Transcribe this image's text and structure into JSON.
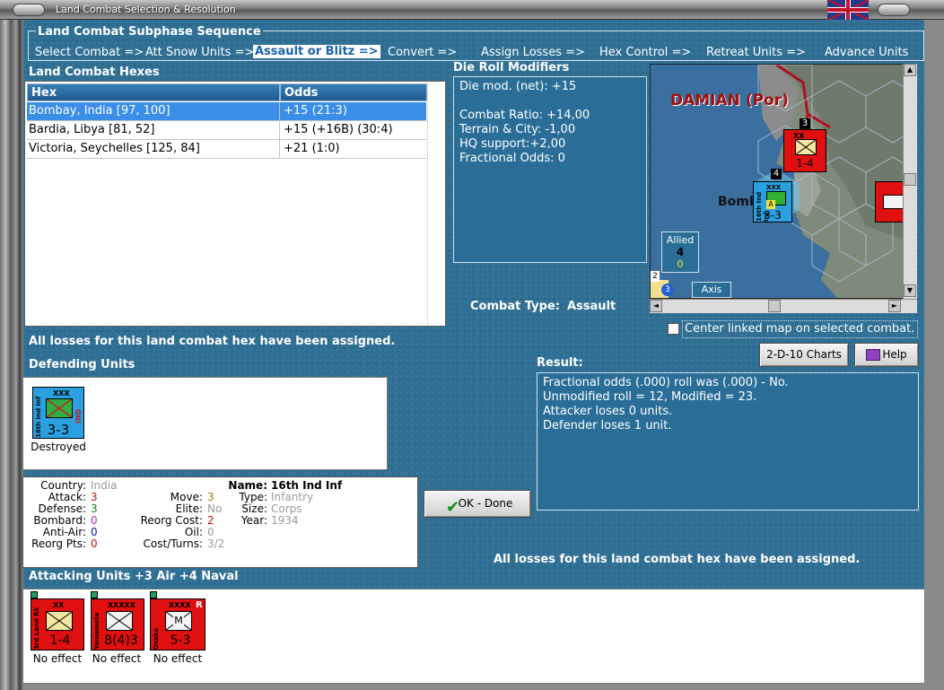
{
  "window": {
    "title": "Land Combat Selection & Resolution"
  },
  "subphase": {
    "title": "Land Combat Subphase Sequence",
    "steps": [
      "Select Combat =>",
      "Att Snow Units =>",
      "Assault or Blitz =>",
      "Convert =>",
      "Assign Losses =>",
      "Hex Control =>",
      "Retreat Units =>",
      "Advance Units"
    ],
    "active_index": 2
  },
  "land_combat_hexes": {
    "label": "Land Combat Hexes",
    "columns": [
      "Hex",
      "Odds"
    ],
    "rows": [
      {
        "hex": "Bombay, India [97, 100]",
        "odds": "+15 (21:3)",
        "selected": true
      },
      {
        "hex": "Bardia, Libya [81, 52]",
        "odds": "+15 (+16B) (30:4)",
        "selected": false
      },
      {
        "hex": "Victoria, Seychelles [125, 84]",
        "odds": "+21 (1:0)",
        "selected": false
      }
    ]
  },
  "die_roll": {
    "label": "Die Roll Modifiers",
    "lines": [
      "Die mod. (net): +15",
      "",
      "Combat Ratio: +14,00",
      "Terrain & City: -1,00",
      "HQ support:+2,00",
      "Fractional Odds: 0"
    ]
  },
  "combat_type": {
    "label": "Combat Type:",
    "value": "Assault"
  },
  "map": {
    "leader_name": "DAMIAN (Por)",
    "city_label": "Bomb",
    "allied_label": "Allied",
    "allied_count": "4",
    "allied_sub": "0",
    "axis_label": "Axis",
    "stack_top_count": "3",
    "stack_mid_count": "4",
    "stack_bottom_count": "2",
    "stack_bottom_badge": "3",
    "counter_top_values": "1-4",
    "counter_mid_values": "3-3",
    "counter_top_size": "XX",
    "counter_mid_size": "XXX",
    "counter_mid_badge": "A",
    "counter_mid_side": "16th Ind Inf"
  },
  "center_linked": {
    "label": "Center linked map on selected combat.",
    "checked": false
  },
  "status_message_top": "All losses for this land combat hex have been assigned.",
  "defending": {
    "label": "Defending Units",
    "units": [
      {
        "size": "XXX",
        "values": "3-3",
        "side_label": "16th Ind Inf",
        "country": "IND",
        "caption": "Destroyed"
      }
    ]
  },
  "buttons": {
    "charts": "2-D-10 Charts",
    "help": "Help",
    "ok": "OK - Done"
  },
  "result": {
    "label": "Result:",
    "lines": [
      "Fractional odds (.000) roll was (.000)  - No.",
      "Unmodified roll = 12, Modified = 23.",
      "Attacker loses 0 units.",
      "Defender loses 1 unit."
    ]
  },
  "unit_info": {
    "left": [
      {
        "label": "Country:",
        "value": "India",
        "color": "#9a9a9a"
      },
      {
        "label": "Attack:",
        "value": "3",
        "color": "#d01010"
      },
      {
        "label": "Defense:",
        "value": "3",
        "color": "#108010"
      },
      {
        "label": "Bombard:",
        "value": "0",
        "color": "#c020c0"
      },
      {
        "label": "Anti-Air:",
        "value": "0",
        "color": "#1010c0"
      },
      {
        "label": "Reorg Pts:",
        "value": "0",
        "color": "#d01010"
      }
    ],
    "middle": [
      {
        "label": "Move:",
        "value": "3",
        "color": "#a08000"
      },
      {
        "label": "Elite:",
        "value": "No",
        "color": "#9a9a9a"
      },
      {
        "label": "Reorg Cost:",
        "value": "2",
        "color": "#d01010"
      },
      {
        "label": "Oil:",
        "value": "0",
        "color": "#9a9a9a"
      },
      {
        "label": "Cost/Turns:",
        "value": "3/2",
        "color": "#9a9a9a"
      }
    ],
    "name_label": "Name:",
    "name_value": "16th Ind Inf",
    "right": [
      {
        "label": "Type:",
        "value": "Infantry"
      },
      {
        "label": "Size:",
        "value": "Corps"
      },
      {
        "label": "Year:",
        "value": "1934"
      }
    ]
  },
  "status_message_bottom": "All losses for this land combat hex have been assigned.",
  "attacking": {
    "label": "Attacking Units +3 Air +4 Naval",
    "units": [
      {
        "size": "XX",
        "values": "1-4",
        "side_label": "3rd Land Rk",
        "symbol": "infantry",
        "caption": "No effect"
      },
      {
        "size": "XXXXX",
        "values": "8(4)3",
        "side_label": "Yamamoto",
        "symbol": "infantry",
        "caption": "No effect"
      },
      {
        "size": "XXXX",
        "values": "5-3",
        "side_label": "Osaka",
        "symbol": "motorized",
        "badge": "R",
        "caption": "No effect"
      }
    ]
  },
  "colors": {
    "panel_blue": "#2f6f94",
    "japan_red": "#e01010",
    "india_blue": "#2aa0e0",
    "selection_blue": "#3a8ee8"
  }
}
